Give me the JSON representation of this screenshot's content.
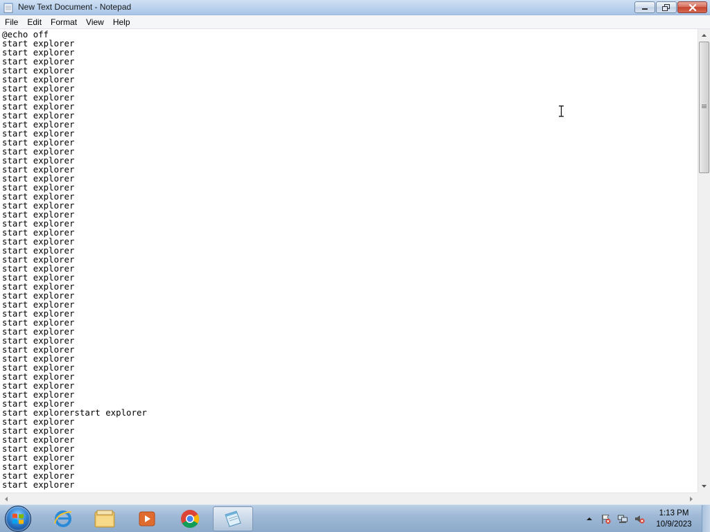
{
  "window": {
    "title": "New Text Document - Notepad",
    "icon": "notepad-icon",
    "controls": [
      "minimize-icon",
      "restore-icon",
      "close-icon"
    ]
  },
  "menu": {
    "file": "File",
    "edit": "Edit",
    "format": "Format",
    "view": "View",
    "help": "Help"
  },
  "editor": {
    "content": "@echo off\nstart explorer\nstart explorer\nstart explorer\nstart explorer\nstart explorer\nstart explorer\nstart explorer\nstart explorer\nstart explorer\nstart explorer\nstart explorer\nstart explorer\nstart explorer\nstart explorer\nstart explorer\nstart explorer\nstart explorer\nstart explorer\nstart explorer\nstart explorer\nstart explorer\nstart explorer\nstart explorer\nstart explorer\nstart explorer\nstart explorer\nstart explorer\nstart explorer\nstart explorer\nstart explorer\nstart explorer\nstart explorer\nstart explorer\nstart explorer\nstart explorer\nstart explorer\nstart explorer\nstart explorer\nstart explorer\nstart explorer\nstart explorer\nstart explorerstart explorer\nstart explorer\nstart explorer\nstart explorer\nstart explorer\nstart explorer\nstart explorer\nstart explorer\nstart explorer"
  },
  "taskbar": {
    "start_icon": "windows-start-orb",
    "pinned": [
      "internet-explorer-icon",
      "file-explorer-icon",
      "media-player-icon",
      "chrome-icon",
      "notepad-icon"
    ],
    "tray_icons": [
      "show-hidden-icons-arrow",
      "action-center-flag-icon",
      "network-icon",
      "volume-muted-icon"
    ],
    "clock_time": "1:13 PM",
    "clock_date": "10/9/2023"
  },
  "colors": {
    "titlebar": "#bcd3ee",
    "close_button": "#c5452f",
    "taskbar": "#9fb9d6"
  }
}
